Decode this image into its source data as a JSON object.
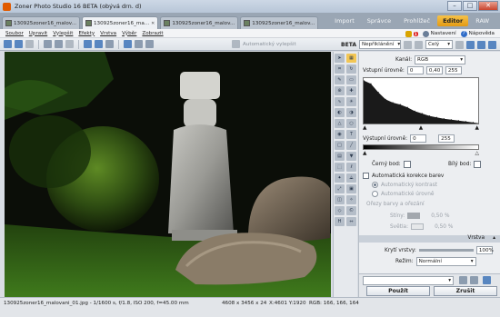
{
  "window": {
    "title": "Zoner Photo Studio 16 BETA (obývá drn. d)",
    "controls": [
      "–",
      "□",
      "✕"
    ]
  },
  "tabs": [
    {
      "label": "130925zoner16_malov...",
      "active": false
    },
    {
      "label": "130925zoner16_ma...",
      "active": true
    },
    {
      "label": "130925zoner16_malov...",
      "active": false
    },
    {
      "label": "130925zoner16_malov...",
      "active": false
    }
  ],
  "modules": [
    "Import",
    "Správce",
    "Prohlížeč",
    "Editor",
    "RAW"
  ],
  "active_module": "Editor",
  "menu": {
    "items": [
      "Soubor",
      "Upravit",
      "Vylepšit",
      "Efekty",
      "Vrstva",
      "Výběr",
      "Zobrazit"
    ],
    "notifications_badge": "1",
    "settings_label": "Nastavení",
    "help_label": "Nápověda"
  },
  "toolbar": {
    "auto_enhance_label": "Automatický vylepšit",
    "beta_label": "BETA",
    "filter_select": "Nepřiklánění",
    "zoom_select": "Celý"
  },
  "panel": {
    "channel_label": "Kanál:",
    "channel_value": "RGB",
    "input_levels_label": "Vstupní úrovně:",
    "input_low": "0",
    "input_gamma": "0,40",
    "input_high": "255",
    "output_levels_label": "Výstupní úrovně:",
    "output_low": "0",
    "output_high": "255",
    "black_point_label": "Černý bod:",
    "white_point_label": "Bílý bod:",
    "auto_color_label": "Automatická korekce barev",
    "auto_contrast_label": "Automatický kontrast",
    "auto_levels_label": "Automatické úrovně",
    "clip_section_label": "Ořezy barvy a ořezání",
    "shadows_label": "Stíny:",
    "shadows_value": "0,50 %",
    "highlights_label": "Světla:",
    "highlights_value": "0,50 %",
    "layer_label": "Vrstva",
    "opacity_label": "Krytí vrstvy:",
    "opacity_value": "100%",
    "mode_label": "Režim:",
    "mode_value": "Normální",
    "apply_button": "Použít",
    "cancel_button": "Zrušit"
  },
  "status": {
    "file_info": "130925zoner16_malovani_01.jpg - 1/1600 s, f/1.8, ISO 200, f=45.00 mm",
    "dimensions": "4608 x 3456 x 24",
    "coords": "X:4601 Y:1920",
    "rgb": "RGB: 166, 166, 164"
  },
  "chart_data": {
    "type": "area",
    "title": "",
    "channel": "RGB",
    "x": [
      0,
      16,
      32,
      48,
      64,
      80,
      96,
      112,
      128,
      144,
      160,
      176,
      192,
      208,
      224,
      240,
      255
    ],
    "y": [
      95,
      88,
      70,
      55,
      48,
      44,
      38,
      30,
      25,
      20,
      17,
      14,
      12,
      10,
      8,
      6,
      4
    ],
    "xlim": [
      0,
      255
    ],
    "ylim": [
      0,
      100
    ]
  }
}
